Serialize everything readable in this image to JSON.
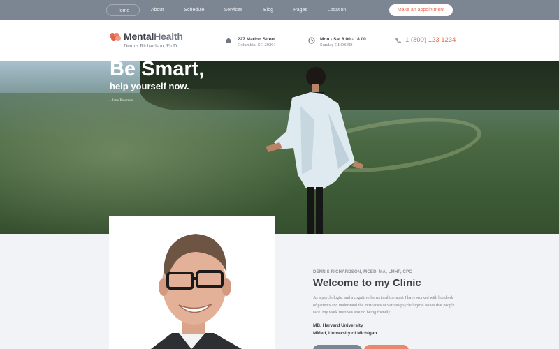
{
  "nav": {
    "items": [
      {
        "label": "Home"
      },
      {
        "label": "About"
      },
      {
        "label": "Schedule"
      },
      {
        "label": "Services"
      },
      {
        "label": "Blog"
      },
      {
        "label": "Pages"
      },
      {
        "label": "Location"
      }
    ],
    "appointment_label": "Make an appointment"
  },
  "header": {
    "logo_primary": "Mental",
    "logo_secondary": "Health",
    "logo_sub": "Dennis Richardson, Ph.D",
    "address_line1": "227 Marion Street",
    "address_line2": "Columbia, SC 29201",
    "hours_line1": "Mon - Sat 8.00 - 18.00",
    "hours_line2": "Sunday CLOSED",
    "phone": "1 (800) 123 1234"
  },
  "hero": {
    "title": "Be Smart,",
    "subtitle": "help yourself now.",
    "author": "- Jane Peterson"
  },
  "about": {
    "credentials": "DENNIS RICHARDSON, MCED, MA, LMHP, CPC",
    "heading": "Welcome to my Clinic",
    "description": "As a psychologist and a cognitive behavioral therapist I have worked with hundreds of patients and understand the intricacies of various psychological issues that people face. My work revolves around being friendly.",
    "education": [
      "MB, Harvard University",
      "MMed, University of Michigan"
    ]
  },
  "colors": {
    "accent": "#e56a4f",
    "nav_bg": "#7c8592",
    "text_dark": "#3c3f45"
  },
  "icons": {
    "logo": "brain-logo-icon",
    "address": "home-icon",
    "hours": "clock-icon",
    "phone": "phone-icon"
  }
}
